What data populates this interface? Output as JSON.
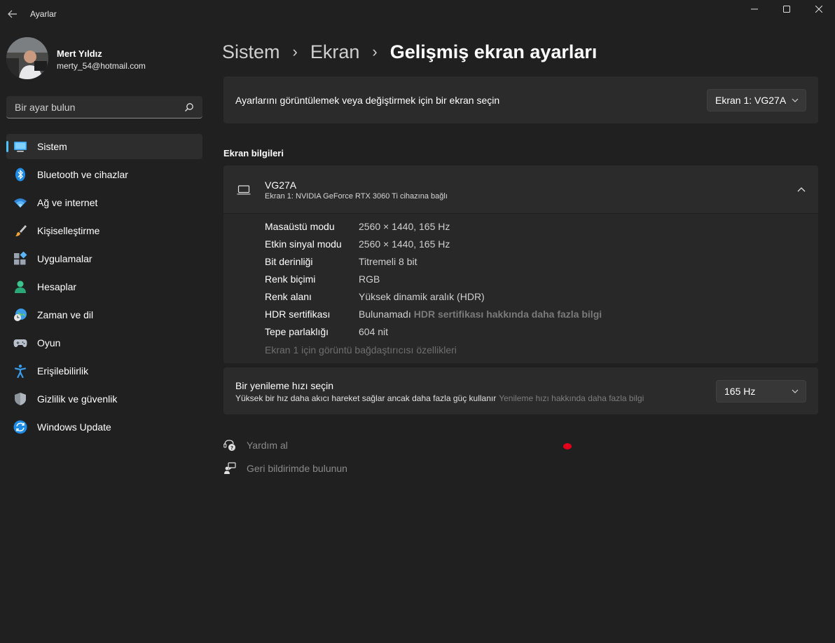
{
  "window": {
    "title": "Ayarlar",
    "back_icon": "back-arrow-icon",
    "minimize_glyph": "—",
    "maximize_glyph": "☐",
    "close_glyph": "✕"
  },
  "profile": {
    "name": "Mert Yıldız",
    "email": "merty_54@hotmail.com"
  },
  "search": {
    "placeholder": "Bir ayar bulun"
  },
  "sidebar": {
    "items": [
      {
        "label": "Sistem",
        "icon": "system-icon",
        "active": true
      },
      {
        "label": "Bluetooth ve cihazlar",
        "icon": "bluetooth-icon"
      },
      {
        "label": "Ağ ve internet",
        "icon": "wifi-icon"
      },
      {
        "label": "Kişiselleştirme",
        "icon": "brush-icon"
      },
      {
        "label": "Uygulamalar",
        "icon": "apps-icon"
      },
      {
        "label": "Hesaplar",
        "icon": "account-icon"
      },
      {
        "label": "Zaman ve dil",
        "icon": "globe-clock-icon"
      },
      {
        "label": "Oyun",
        "icon": "gamepad-icon"
      },
      {
        "label": "Erişilebilirlik",
        "icon": "accessibility-icon"
      },
      {
        "label": "Gizlilik ve güvenlik",
        "icon": "shield-icon"
      },
      {
        "label": "Windows Update",
        "icon": "update-icon"
      }
    ]
  },
  "breadcrumb": {
    "items": [
      "Sistem",
      "Ekran"
    ],
    "separator": "›",
    "current": "Gelişmiş ekran ayarları"
  },
  "display_select": {
    "text": "Ayarlarını görüntülemek veya değiştirmek için bir ekran seçin",
    "selected": "Ekran 1: VG27A"
  },
  "display_info": {
    "section_title": "Ekran bilgileri",
    "name": "VG27A",
    "subtitle": "Ekran 1: NVIDIA GeForce RTX 3060 Ti cihazına bağlı",
    "rows": [
      {
        "key": "Masaüstü modu",
        "value": "2560 × 1440, 165 Hz"
      },
      {
        "key": "Etkin sinyal modu",
        "value": "2560 × 1440, 165 Hz"
      },
      {
        "key": "Bit derinliği",
        "value": "Titremeli 8 bit"
      },
      {
        "key": "Renk biçimi",
        "value": "RGB"
      },
      {
        "key": "Renk alanı",
        "value": "Yüksek dinamik aralık (HDR)"
      },
      {
        "key": "HDR sertifikası",
        "value": "Bulunamadı",
        "link": "HDR sertifikası hakkında daha fazla bilgi"
      },
      {
        "key": "Tepe parlaklığı",
        "value": "604 nit"
      }
    ],
    "adapter_link": "Ekran 1 için görüntü bağdaştırıcısı özellikleri"
  },
  "refresh_rate": {
    "title": "Bir yenileme hızı seçin",
    "description": "Yüksek bir hız daha akıcı hareket sağlar ancak daha fazla güç kullanır",
    "link": "Yenileme hızı hakkında daha fazla bilgi",
    "selected": "165 Hz"
  },
  "footer_links": {
    "help": "Yardım al",
    "feedback": "Geri bildirimde bulunun"
  },
  "colors": {
    "background": "#202020",
    "card": "#2b2b2b",
    "accent": "#4cc2ff",
    "annotation_mark": "#e3001b"
  }
}
